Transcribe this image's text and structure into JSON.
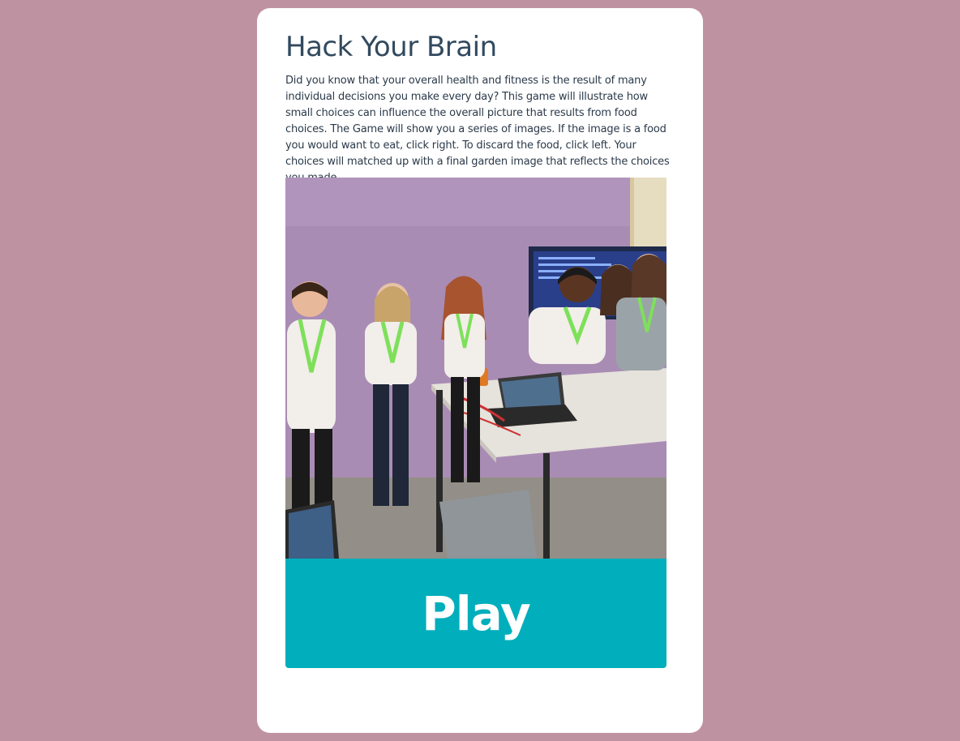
{
  "page": {
    "title": "Hack Your Brain",
    "intro": "Did you know that your overall health and fitness is the result of many individual decisions you make every day? This game will illustrate how small choices can influence the overall picture that results from food choices. The Game will show you a series of images. If the image is a food you would want to eat, click right. To discard the food, click left. Your choices will matched up with a final garden image that reflects the choices you made.",
    "play_label": "Play"
  },
  "photo": {
    "subject": "group-photo-of-women-at-hackathon-table"
  },
  "colors": {
    "background": "#bf92a2",
    "card": "#ffffff",
    "title": "#324a5f",
    "text": "#2b3a4a",
    "play_button": "#00aebc",
    "play_text": "#ffffff"
  }
}
